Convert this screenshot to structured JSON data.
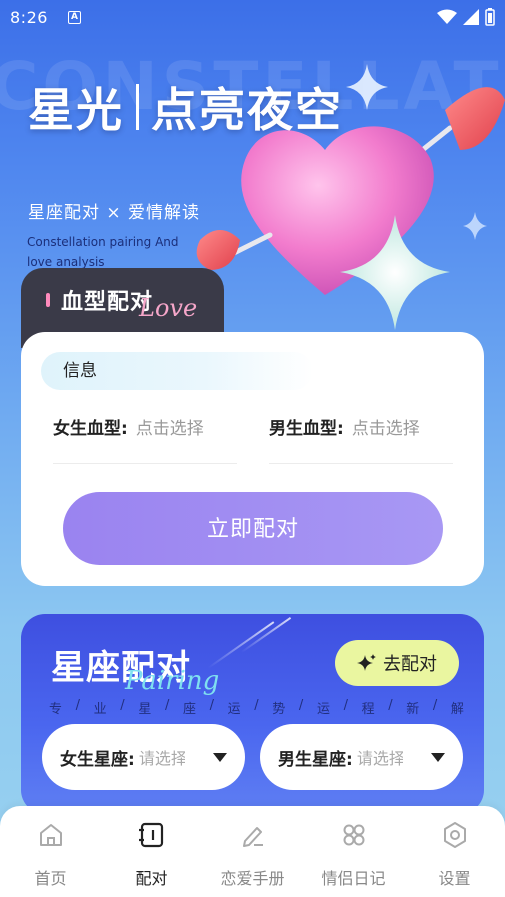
{
  "status_bar": {
    "time": "8:26",
    "notification_letter": "A"
  },
  "hero": {
    "background_word": "CONSTELLATION",
    "title_left": "星光",
    "title_right": "点亮夜空",
    "subtitle": "星座配对 × 爱情解读",
    "subtitle_en": "Constellation pairing And love analysis"
  },
  "blood_section": {
    "tab_title": "血型配对",
    "tab_script": "Love",
    "info_chip": "信息",
    "female_label": "女生血型:",
    "female_value": "点击选择",
    "male_label": "男生血型:",
    "male_value": "点击选择",
    "match_button": "立即配对"
  },
  "zodiac_section": {
    "title": "星座配对",
    "script": "Pairing",
    "go_button": "去配对",
    "tagline": [
      "专",
      "/",
      "业",
      "/",
      "星",
      "/",
      "座",
      "/",
      "运",
      "/",
      "势",
      "/",
      "运",
      "/",
      "程",
      "/",
      "新",
      "/",
      "解"
    ],
    "female_label": "女生星座:",
    "female_value": "请选择",
    "male_label": "男生星座:",
    "male_value": "请选择"
  },
  "bottom_nav": [
    {
      "label": "首页",
      "icon": "home-icon",
      "active": false
    },
    {
      "label": "配对",
      "icon": "pair-icon",
      "active": true
    },
    {
      "label": "恋爱手册",
      "icon": "edit-icon",
      "active": false
    },
    {
      "label": "情侣日记",
      "icon": "grid-icon",
      "active": false
    },
    {
      "label": "设置",
      "icon": "settings-icon",
      "active": false
    }
  ],
  "colors": {
    "accent_purple": "#9a83f0",
    "go_button_bg": "#eaf6a0",
    "zodiac_card_bg": "#4a66ef",
    "tab_dark": "#3a3a48"
  }
}
